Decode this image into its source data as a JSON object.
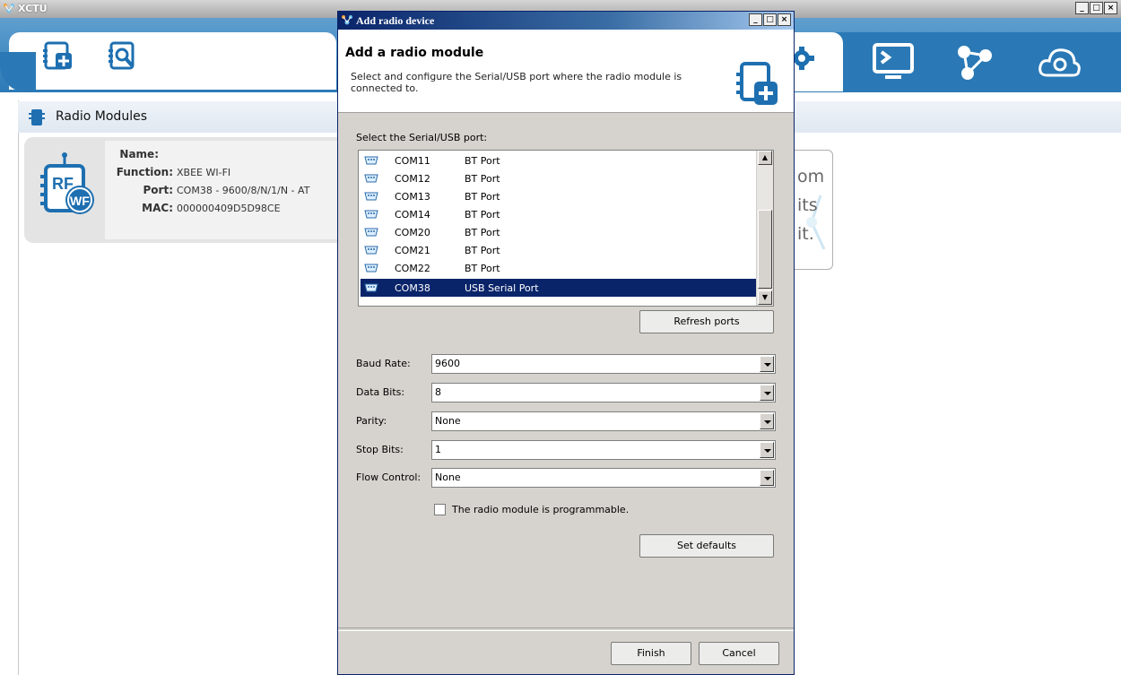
{
  "main_window": {
    "title": "XCTU",
    "controls": [
      "_",
      "□",
      "×"
    ]
  },
  "toolbar": {
    "add_device_icon": "add-radio-plus-icon",
    "discover_icon": "discover-search-icon",
    "right_icons": [
      "configuration-gear-icon",
      "console-terminal-icon",
      "network-icon",
      "tools-cloud-gear-icon"
    ]
  },
  "radio_modules": {
    "header": "Radio Modules",
    "device": {
      "name_label": "Name:",
      "name_value": "",
      "function_label": "Function:",
      "function_value": "XBEE WI-FI",
      "port_label": "Port:",
      "port_value": "COM38 - 9600/8/N/1/N - AT",
      "mac_label": "MAC:",
      "mac_value": "000000409D5D98CE",
      "badge_top": "RF",
      "badge_bottom": "WF"
    }
  },
  "hint_text": [
    "om",
    "its",
    "it."
  ],
  "dialog": {
    "title": "Add radio device",
    "controls": [
      "_",
      "□",
      "×"
    ],
    "heading": "Add a radio module",
    "description": "Select and configure the Serial/USB port where the radio module is connected to.",
    "port_list_label": "Select the Serial/USB port:",
    "ports": [
      {
        "name": "COM11",
        "desc": "BT Port",
        "selected": false
      },
      {
        "name": "COM12",
        "desc": "BT Port",
        "selected": false
      },
      {
        "name": "COM13",
        "desc": "BT Port",
        "selected": false
      },
      {
        "name": "COM14",
        "desc": "BT Port",
        "selected": false
      },
      {
        "name": "COM20",
        "desc": "BT Port",
        "selected": false
      },
      {
        "name": "COM21",
        "desc": "BT Port",
        "selected": false
      },
      {
        "name": "COM22",
        "desc": "BT Port",
        "selected": false
      },
      {
        "name": "COM38",
        "desc": "USB Serial Port",
        "selected": true
      }
    ],
    "refresh_button": "Refresh ports",
    "baud_rate_label": "Baud Rate:",
    "baud_rate_value": "9600",
    "data_bits_label": "Data Bits:",
    "data_bits_value": "8",
    "parity_label": "Parity:",
    "parity_value": "None",
    "stop_bits_label": "Stop Bits:",
    "stop_bits_value": "1",
    "flow_control_label": "Flow Control:",
    "flow_control_value": "None",
    "programmable_label": "The radio module is programmable.",
    "programmable_checked": false,
    "set_defaults_button": "Set defaults",
    "finish_button": "Finish",
    "cancel_button": "Cancel"
  },
  "colors": {
    "toolbar_blue": "#2a79b6",
    "selection": "#0a246a",
    "dialog_face": "#d6d3ce"
  }
}
